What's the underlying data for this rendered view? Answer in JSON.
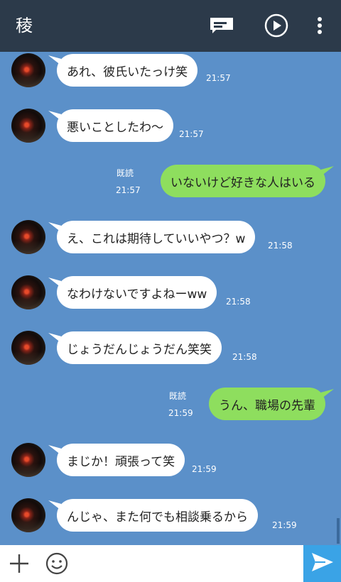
{
  "header": {
    "title": "稜",
    "icons": [
      "note-icon",
      "play-icon",
      "more-vertical-icon"
    ]
  },
  "messages": [
    {
      "side": "in",
      "text": "あれ、彼氏いたっけ笑",
      "time": "21:57"
    },
    {
      "side": "in",
      "text": "悪いことしたわ〜",
      "time": "21:57"
    },
    {
      "side": "out",
      "text": "いないけど好きな人はいる",
      "time": "21:57",
      "read": "既読"
    },
    {
      "side": "in",
      "text": "え、これは期待していいやつ？w",
      "time": "21:58"
    },
    {
      "side": "in",
      "text": "なわけないですよねーww",
      "time": "21:58"
    },
    {
      "side": "in",
      "text": "じょうだんじょうだん笑笑",
      "time": "21:58"
    },
    {
      "side": "out",
      "text": "うん、職場の先輩",
      "time": "21:59",
      "read": "既読"
    },
    {
      "side": "in",
      "text": "まじか！頑張って笑",
      "time": "21:59"
    },
    {
      "side": "in",
      "text": "んじゃ、また何でも相談乗るから",
      "time": "21:59"
    }
  ],
  "input": {
    "icons": [
      "plus-icon",
      "smiley-icon",
      "send-icon"
    ]
  },
  "colors": {
    "header": "#2c3a4a",
    "chat_background": "#5b90c9",
    "incoming_bubble": "#ffffff",
    "outgoing_bubble": "#8ede5e",
    "send_button": "#3aa3e6"
  }
}
